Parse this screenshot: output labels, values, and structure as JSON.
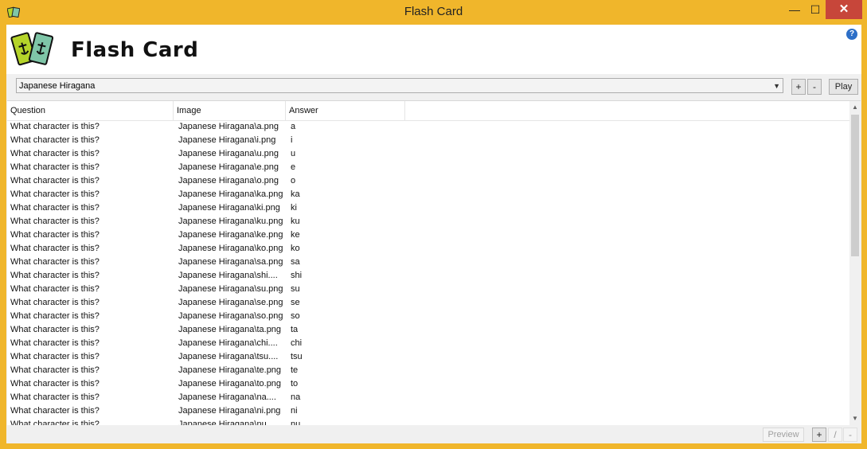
{
  "window": {
    "title": "Flash Card",
    "minimize_glyph": "—",
    "maximize_glyph": "☐",
    "close_glyph": "✕"
  },
  "header": {
    "app_title": "Flash Card",
    "help_glyph": "?"
  },
  "deck": {
    "selected": "Japanese Hiragana",
    "add_label": "+",
    "remove_label": "-",
    "play_label": "Play"
  },
  "table": {
    "columns": [
      "Question",
      "Image",
      "Answer"
    ],
    "rows": [
      {
        "question": "What character is this?",
        "image": "Japanese Hiragana\\a.png",
        "answer": "a"
      },
      {
        "question": "What character is this?",
        "image": "Japanese Hiragana\\i.png",
        "answer": "i"
      },
      {
        "question": "What character is this?",
        "image": "Japanese Hiragana\\u.png",
        "answer": "u"
      },
      {
        "question": "What character is this?",
        "image": "Japanese Hiragana\\e.png",
        "answer": "e"
      },
      {
        "question": "What character is this?",
        "image": "Japanese Hiragana\\o.png",
        "answer": "o"
      },
      {
        "question": "What character is this?",
        "image": "Japanese Hiragana\\ka.png",
        "answer": "ka"
      },
      {
        "question": "What character is this?",
        "image": "Japanese Hiragana\\ki.png",
        "answer": "ki"
      },
      {
        "question": "What character is this?",
        "image": "Japanese Hiragana\\ku.png",
        "answer": "ku"
      },
      {
        "question": "What character is this?",
        "image": "Japanese Hiragana\\ke.png",
        "answer": "ke"
      },
      {
        "question": "What character is this?",
        "image": "Japanese Hiragana\\ko.png",
        "answer": "ko"
      },
      {
        "question": "What character is this?",
        "image": "Japanese Hiragana\\sa.png",
        "answer": "sa"
      },
      {
        "question": "What character is this?",
        "image": "Japanese Hiragana\\shi....",
        "answer": "shi"
      },
      {
        "question": "What character is this?",
        "image": "Japanese Hiragana\\su.png",
        "answer": "su"
      },
      {
        "question": "What character is this?",
        "image": "Japanese Hiragana\\se.png",
        "answer": "se"
      },
      {
        "question": "What character is this?",
        "image": "Japanese Hiragana\\so.png",
        "answer": "so"
      },
      {
        "question": "What character is this?",
        "image": "Japanese Hiragana\\ta.png",
        "answer": "ta"
      },
      {
        "question": "What character is this?",
        "image": "Japanese Hiragana\\chi....",
        "answer": "chi"
      },
      {
        "question": "What character is this?",
        "image": "Japanese Hiragana\\tsu....",
        "answer": "tsu"
      },
      {
        "question": "What character is this?",
        "image": "Japanese Hiragana\\te.png",
        "answer": "te"
      },
      {
        "question": "What character is this?",
        "image": "Japanese Hiragana\\to.png",
        "answer": "to"
      },
      {
        "question": "What character is this?",
        "image": "Japanese Hiragana\\na....",
        "answer": "na"
      },
      {
        "question": "What character is this?",
        "image": "Japanese Hiragana\\ni.png",
        "answer": "ni"
      },
      {
        "question": "What character is this?",
        "image": "Japanese Hiragana\\nu....",
        "answer": "nu"
      }
    ]
  },
  "footer": {
    "preview_label": "Preview",
    "add_label": "+",
    "edit_label": "/",
    "remove_label": "-"
  },
  "colors": {
    "titlebar": "#f0b62b",
    "close_button": "#c7463a",
    "help_icon": "#2d6fc7",
    "logo_card_front": "#b5d42a",
    "logo_card_back": "#7fc6a8"
  },
  "icons": {
    "app": "flash-card-app-icon",
    "logo": "flash-card-logo-icon",
    "help": "help-icon",
    "dropdown": "chevron-down-icon",
    "scroll_up": "scroll-up-arrow-icon",
    "scroll_down": "scroll-down-arrow-icon"
  }
}
